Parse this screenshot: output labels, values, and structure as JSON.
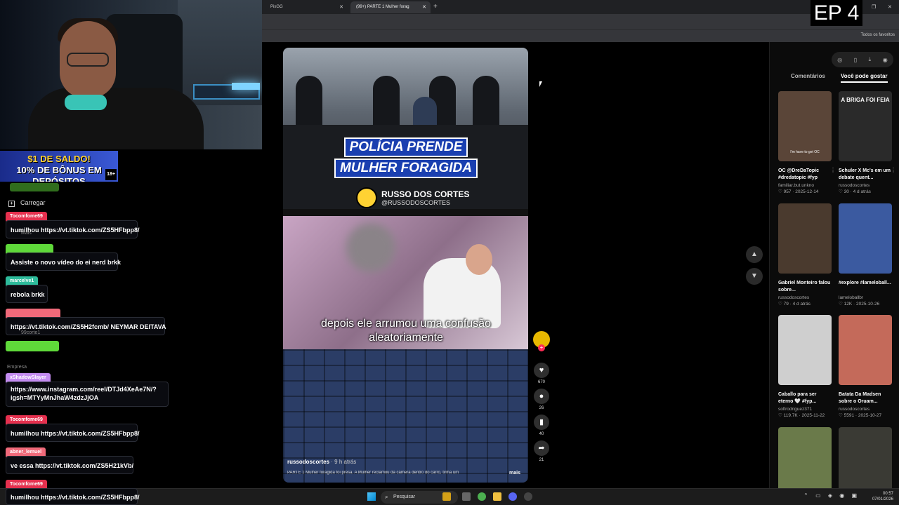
{
  "overlay": {
    "promo_line1": "$1 DE SALDO!",
    "promo_line2": "10% DE BÔNUS EM DEPÓSITOS",
    "promo_age": "18+",
    "episode": "EP 4"
  },
  "chat": {
    "carregar": "Carregar",
    "messages": [
      {
        "user": "Tocomfome69",
        "color": "#e5304e",
        "text": "humilhou https://vt.tiktok.com/ZS5HFbpp8/"
      },
      {
        "user": "",
        "color": "#5fd93a",
        "text": "Assiste o novo vídeo do ei nerd brkk"
      },
      {
        "user": "marcelve1",
        "color": "#2ebc9c",
        "text": "rebola brkk"
      },
      {
        "user": "",
        "color": "#f06a7a",
        "text": "https://vt.tiktok.com/ZS5H2fcmb/ NEYMAR DEITAVA"
      },
      {
        "user": "xShadowSlayer",
        "color": "#c48cf0",
        "text": "https://www.instagram.com/reel/DTJd4XeAe7N/?igsh=MTYyMnJhaW4zdzJjOA"
      },
      {
        "user": "Tocomfome69",
        "color": "#e5304e",
        "text": "humilhou https://vt.tiktok.com/ZS5HFbpp8/"
      },
      {
        "user": "abner_lemuel",
        "color": "#f06a7a",
        "text": "ve essa https://vt.tiktok.com/ZS5H21kVb/"
      },
      {
        "user": "Tocomfome69",
        "color": "#e5304e",
        "text": "humilhou https://vt.tiktok.com/ZS5HFbpp8/"
      }
    ],
    "ghost": [
      "Mais",
      "99corte1",
      "Empresa"
    ]
  },
  "browser": {
    "tabs": [
      {
        "title": "PixGG"
      },
      {
        "title": "(99+) PARTE 1 Mulher forag"
      }
    ],
    "favorites": "Todos os favoritos"
  },
  "video": {
    "headline_1": "POLÍCIA PRENDE",
    "headline_2": "MULHER FORAGIDA",
    "brand_name": "RUSSO DOS CORTES",
    "brand_handle": "@RUSSODOSCORTES",
    "caption": "depois ele arrumou uma confusão aleatoriamente",
    "username": "russodoscortes",
    "time": "· 9 h atrás",
    "description": "PARTE 1 Mulher foragida foi presa. A Mulher reclamou da câmera dentro do carro, tinha um",
    "more": "mais",
    "likes": "670",
    "comments": "26",
    "saves": "40",
    "shares": "21"
  },
  "sidebar": {
    "tab_comments": "Comentários",
    "tab_suggest": "Você pode gostar",
    "cards": [
      {
        "title": "OC @DreDaTopic #dredatopic #fyp",
        "user": "familiar.but.unkno",
        "stats": "♡ 957 · 2025-12-14",
        "label": "I'm have to get OC",
        "color": "#5a4538"
      },
      {
        "title": "Schuler X Mc's em um debate quent...",
        "user": "russodoscortes",
        "stats": "♡ 30 · 4 d atrás",
        "label": "A BRIGA FOI FEIA",
        "color": "#2a2a2a"
      },
      {
        "title": "Gabriel Monteiro falou sobre...",
        "user": "russodoscortes",
        "stats": "♡ 79 · 4 d atrás",
        "label": "",
        "color": "#4a3a2e"
      },
      {
        "title": "#explore #lameloball...",
        "user": "lameloballbr",
        "stats": "♡ 12K · 2025-10-26",
        "label": "",
        "color": "#3b5aa0"
      },
      {
        "title": "Caballo para ser eterno 🤍 #fyp...",
        "user": "sofirodriguez371",
        "stats": "♡ 119.7K · 2025-11-22",
        "label": "",
        "color": "#cfcfcf"
      },
      {
        "title": "Batata Da Madsen sobre o Oruam...",
        "user": "russodoscortes",
        "stats": "♡ 5591 · 2025-10-27",
        "label": "",
        "color": "#c46a5a"
      },
      {
        "title": "",
        "user": "",
        "stats": "",
        "label": "",
        "color": "#6a7a4a"
      },
      {
        "title": "",
        "user": "",
        "stats": "",
        "label": "",
        "color": "#3a3a34"
      }
    ]
  },
  "taskbar": {
    "search": "Pesquisar",
    "time": "00:57",
    "date": "07/01/2026"
  }
}
